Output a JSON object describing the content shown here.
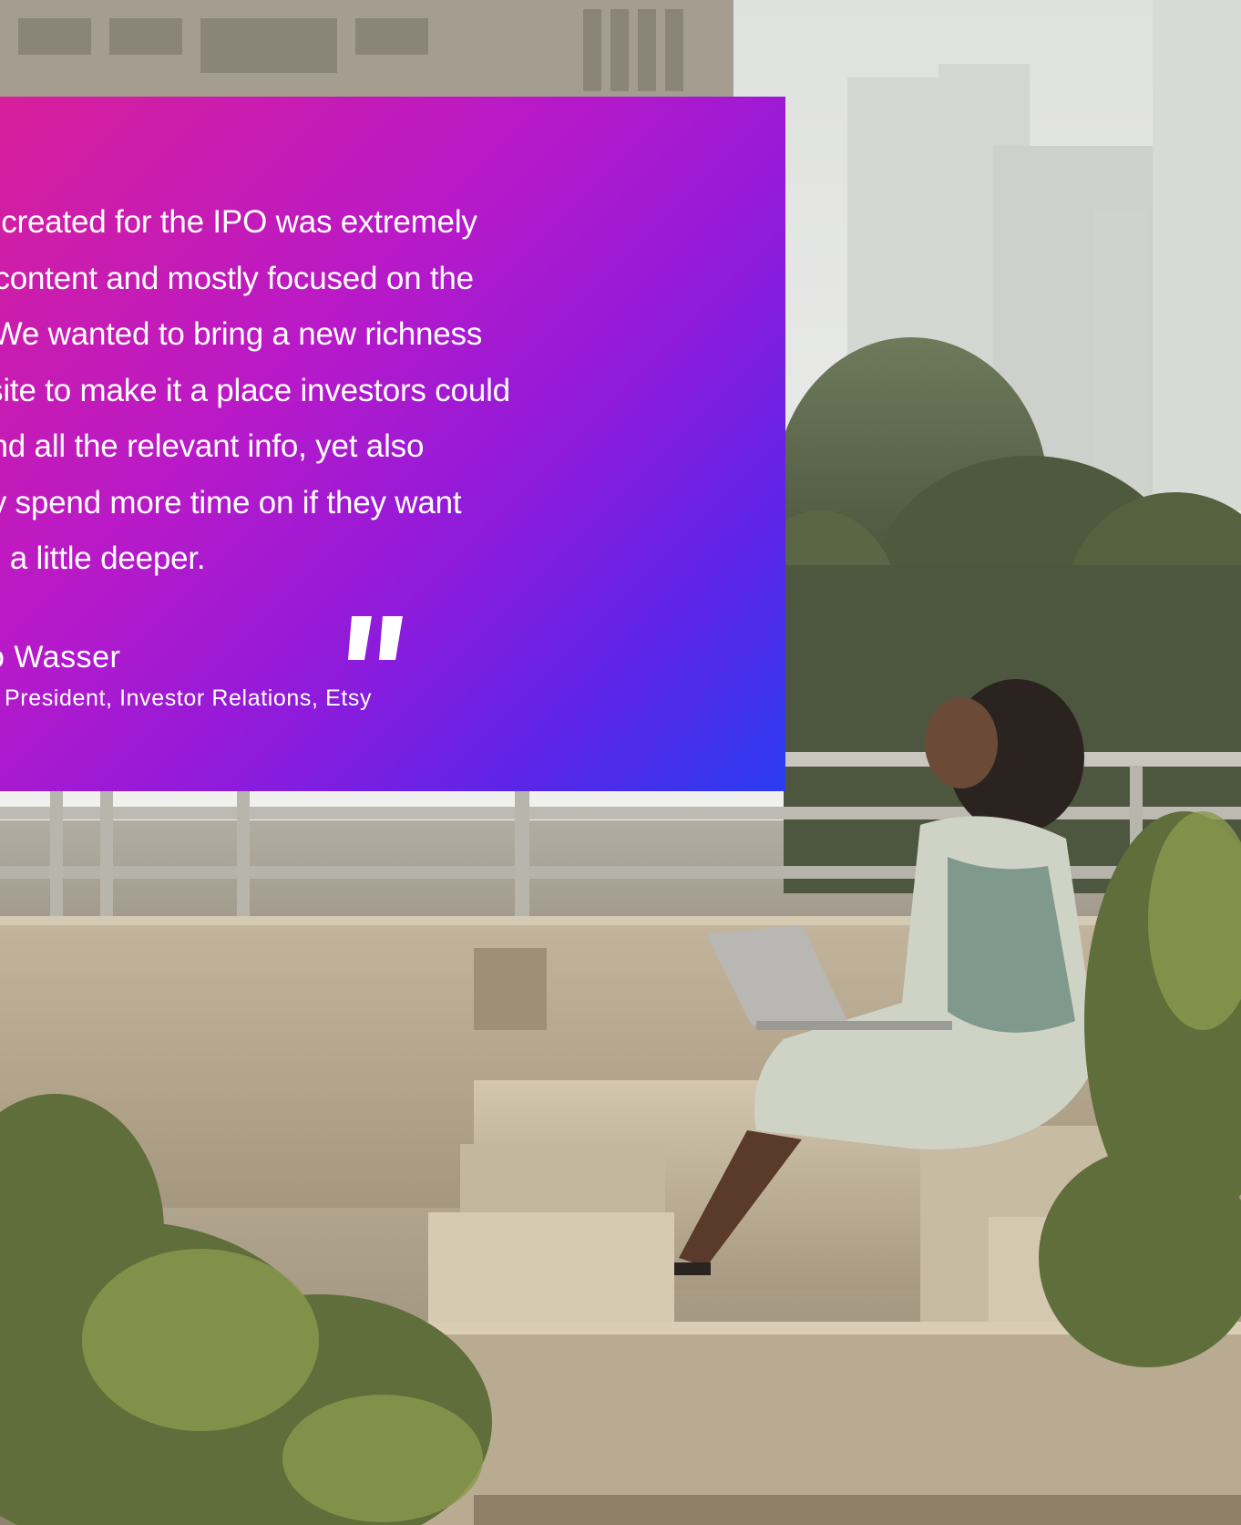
{
  "quote": {
    "text": "site created for the IPO was extremely t in content and mostly focused on the cs. We wanted to bring a new richness he site to make it a place investors could ly find all the relevant info, yet also sibly spend more time on if they want ig in a little deeper.",
    "lines": [
      "site created for the IPO was extremely",
      "t in content and mostly focused on the",
      "cs. We wanted to bring a new richness",
      "he site to make it a place investors could",
      "ly find all the relevant info, yet also",
      "sibly spend more time on if they want",
      "ig in a little deeper."
    ],
    "mark_icon": "closing-quote-icon",
    "author_name": "o Wasser",
    "author_title": "President, Investor Relations, Etsy",
    "card_gradient": [
      "#d81f9a",
      "#8e1bdc",
      "#2b3cf0"
    ]
  },
  "photo": {
    "subject": "woman-with-laptop-on-rooftop-bench-illustration"
  }
}
